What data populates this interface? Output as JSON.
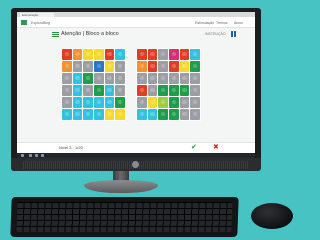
{
  "app": {
    "tab_label": "Estimulação",
    "menu": [
      "Exploro",
      "Blog"
    ],
    "nav": [
      "Estimulação",
      "Treinos",
      "Aluno"
    ],
    "title": "Atenção | Bloco a bloco",
    "instruction_label": "INSTRUÇÃO",
    "level_text": "Nível 3 - 1/20",
    "confirm_icon": "check-icon",
    "reject_icon": "x-icon"
  },
  "colors": {
    "red": "#e23b26",
    "orange": "#f2922e",
    "yellow": "#f5d92b",
    "lime": "#9ccf3f",
    "green": "#1f9d4b",
    "blue": "#2a76c9",
    "cyan": "#31c2e0",
    "gray": "#9b9ea2",
    "pink": "#d62f6f",
    "accent_green": "#1b9a3a",
    "accent_red": "#d7261d"
  },
  "boards": {
    "left": [
      [
        "red",
        "orange",
        "yellow",
        "yellow",
        "red",
        "cyan"
      ],
      [
        "orange",
        "gray",
        "gray",
        "blue",
        "yellow",
        "gray"
      ],
      [
        "gray",
        "cyan",
        "green",
        "gray",
        "gray",
        "gray"
      ],
      [
        "gray",
        "cyan",
        "gray",
        "green",
        "cyan",
        "gray"
      ],
      [
        "gray",
        "cyan",
        "cyan",
        "cyan",
        "cyan",
        "green"
      ],
      [
        "cyan",
        "cyan",
        "cyan",
        "cyan",
        "yellow",
        "yellow"
      ]
    ],
    "right": [
      [
        "red",
        "red",
        "gray",
        "pink",
        "red",
        "cyan"
      ],
      [
        "orange",
        "red",
        "gray",
        "red",
        "yellow",
        "green"
      ],
      [
        "gray",
        "gray",
        "gray",
        "gray",
        "gray",
        "gray"
      ],
      [
        "red",
        "gray",
        "green",
        "green",
        "green",
        "gray"
      ],
      [
        "gray",
        "yellow",
        "lime",
        "green",
        "gray",
        "gray"
      ],
      [
        "cyan",
        "cyan",
        "green",
        "green",
        "gray",
        "gray"
      ]
    ]
  }
}
